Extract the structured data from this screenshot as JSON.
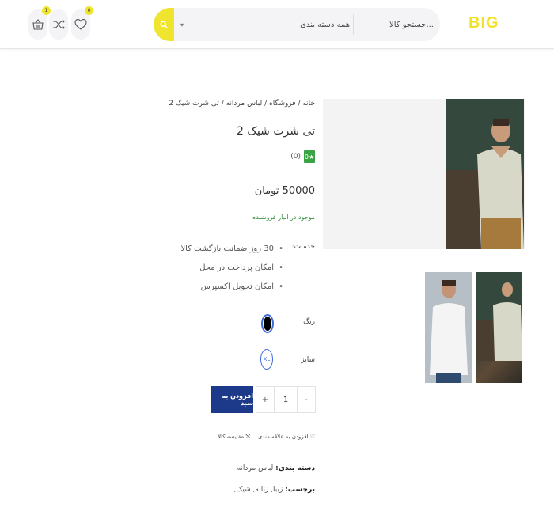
{
  "header": {
    "logo": "BIG",
    "search_placeholder": "جستجو کالا...",
    "category_select": "همه دسته بندی",
    "cart_count": "1",
    "wishlist_count": "0"
  },
  "product": {
    "breadcrumb": "خانه / فروشگاه / لباس مردانه / تی شرت شیک 2",
    "title": "تی شرت شیک 2",
    "rating": "0",
    "rating_count": "(0)",
    "price": "50000 تومان",
    "stock": "موجود در انبار فروشنده",
    "services_label": "خدمات:",
    "services": [
      "30 روز ضمانت بازگشت کالا",
      "امکان پرداخت در محل",
      "امکان تحویل اکسپرس"
    ],
    "color_label": "رنگ",
    "size_label": "سایز",
    "size_value": "XL",
    "quantity": "1",
    "qty_plus": "+",
    "qty_minus": "-",
    "add_to_cart": "افزودن به سبد",
    "add_wishlist": "افزودن به علاقه مندی",
    "compare": "مقایسه کالا",
    "category_label": "دسته بندی:",
    "category_value": "لباس مردانه",
    "tags_label": "برچسب:",
    "tags_value": "زیبا, زنانه, شیک,"
  },
  "colors": {
    "accent": "#f0e52e",
    "button": "#1d3a8a",
    "stock_green": "#2e8b3a",
    "swatch_ring": "#3f6ad8"
  }
}
